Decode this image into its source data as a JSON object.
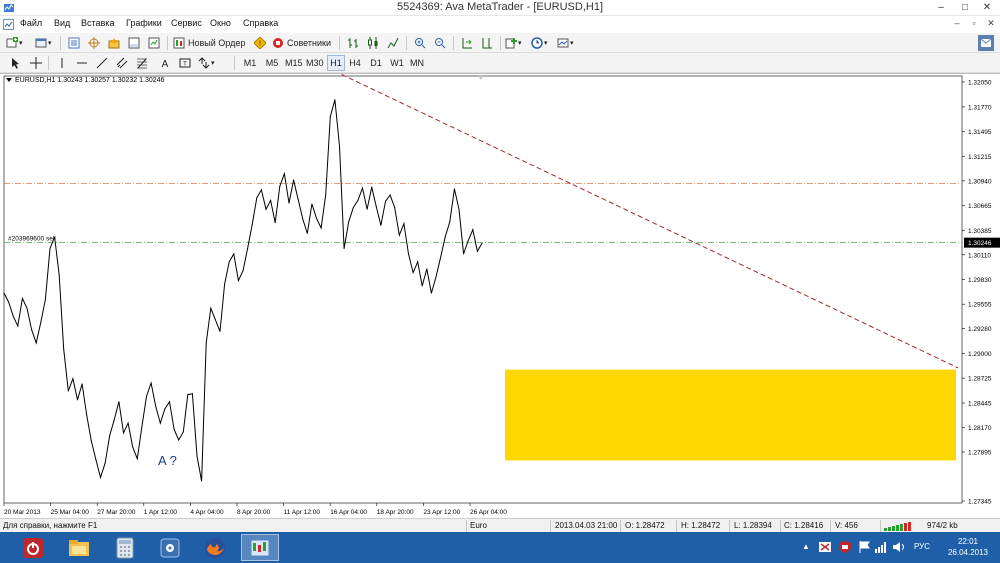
{
  "window": {
    "title": "5524369: Ava MetaTrader - [EURUSD,H1]",
    "controls": [
      "–",
      "□",
      "✕"
    ]
  },
  "menu": {
    "items": [
      "Файл",
      "Вид",
      "Вставка",
      "Графики",
      "Сервис",
      "Окно",
      "Справка"
    ],
    "right_controls": [
      "–",
      "▫",
      "✕"
    ]
  },
  "toolbar": {
    "new_order_label": "Новый Ордер",
    "advisors_label": "Советники",
    "timeframes": [
      "M1",
      "M5",
      "M15",
      "M30",
      "H1",
      "H4",
      "D1",
      "W1",
      "MN"
    ],
    "active_timeframe": "H1"
  },
  "chart": {
    "header": "EURUSD,H1  1.30243 1.30257 1.30232 1.30246",
    "order_label": "#203969600 sell",
    "current_price_label": "1.30246",
    "annotation": "A ?",
    "colors": {
      "resistance_line": "#e07b4a",
      "order_line": "#5aa65a",
      "trend_line": "#9a2e2e",
      "zone": "#ffd700",
      "price_box": "#000000"
    }
  },
  "chart_data": {
    "type": "line",
    "symbol": "EURUSD",
    "timeframe": "H1",
    "ylim": [
      1.27345,
      1.3205
    ],
    "y_ticks": [
      "1.32050",
      "1.31770",
      "1.31495",
      "1.31215",
      "1.30940",
      "1.30665",
      "1.30385",
      "1.30110",
      "1.29830",
      "1.29555",
      "1.29280",
      "1.29000",
      "1.28725",
      "1.28445",
      "1.28170",
      "1.27895",
      "1.27345"
    ],
    "x_ticks": [
      "20 Mar 2013",
      "25 Mar 04:00",
      "27 Mar 20:00",
      "1 Apr 12:00",
      "4 Apr 04:00",
      "8 Apr 20:00",
      "11 Apr 12:00",
      "16 Apr 04:00",
      "18 Apr 20:00",
      "23 Apr 12:00",
      "26 Apr 04:00"
    ],
    "horizontal_lines": [
      1.3091,
      1.30246
    ],
    "values": [
      1.2968,
      1.2958,
      1.2942,
      1.2931,
      1.2962,
      1.2951,
      1.2927,
      1.2912,
      1.2935,
      1.2961,
      1.3018,
      1.3031,
      1.2988,
      1.2905,
      1.2858,
      1.2872,
      1.2848,
      1.2866,
      1.2831,
      1.2802,
      1.2781,
      1.2761,
      1.2777,
      1.2808,
      1.2826,
      1.2846,
      1.2811,
      1.2822,
      1.2795,
      1.2782,
      1.2818,
      1.2852,
      1.2867,
      1.2841,
      1.2822,
      1.2838,
      1.2846,
      1.2815,
      1.2803,
      1.2812,
      1.2854,
      1.2855,
      1.2785,
      1.2757,
      1.2912,
      1.2951,
      1.2938,
      1.2925,
      1.2978,
      1.3003,
      1.3012,
      1.2982,
      1.2993,
      1.3018,
      1.3045,
      1.3075,
      1.3084,
      1.3062,
      1.3072,
      1.3047,
      1.3088,
      1.3102,
      1.3069,
      1.3095,
      1.3073,
      1.3051,
      1.3035,
      1.3068,
      1.3052,
      1.3041,
      1.3078,
      1.3166,
      1.3185,
      1.3133,
      1.3018,
      1.3048,
      1.3064,
      1.3072,
      1.3086,
      1.3062,
      1.3087,
      1.3065,
      1.3044,
      1.3071,
      1.3078,
      1.3064,
      1.3033,
      1.3046,
      1.3012,
      1.2991,
      1.3003,
      1.2976,
      1.2995,
      1.2968,
      1.2986,
      1.3008,
      1.3031,
      1.3048,
      1.3085,
      1.3062,
      1.3012,
      1.3027,
      1.3039,
      1.3015,
      1.3024
    ]
  },
  "status": {
    "help": "Для справки, нажмите F1",
    "profile": "Euro",
    "time": "2013.04.03 21:00",
    "open": "O: 1.28472",
    "high": "H: 1.28472",
    "low": "L: 1.28394",
    "close": "C: 1.28416",
    "volume": "V: 456",
    "traffic": "974/2 kb"
  },
  "taskbar": {
    "language": "РУС",
    "time": "22:01",
    "date": "26.04.2013"
  }
}
